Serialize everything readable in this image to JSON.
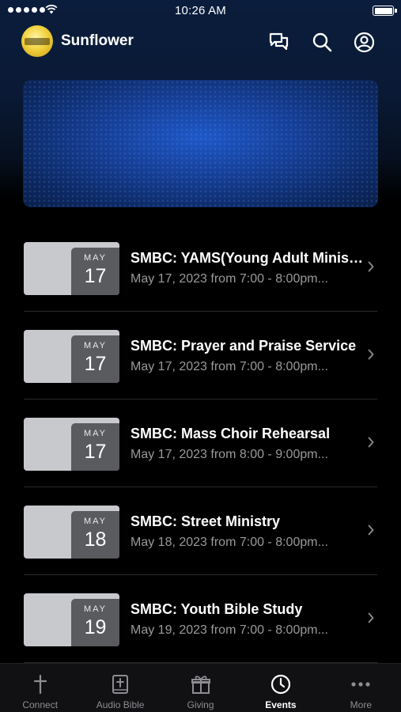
{
  "status_bar": {
    "time": "10:26 AM"
  },
  "header": {
    "app_name": "Sunflower"
  },
  "events": [
    {
      "month": "MAY",
      "day": "17",
      "title": "SMBC: YAMS(Young Adult Ministry)",
      "time": "May 17, 2023 from 7:00 - 8:00pm..."
    },
    {
      "month": "MAY",
      "day": "17",
      "title": "SMBC: Prayer and Praise Service",
      "time": "May 17, 2023 from 7:00 - 8:00pm..."
    },
    {
      "month": "MAY",
      "day": "17",
      "title": "SMBC: Mass Choir Rehearsal",
      "time": "May 17, 2023 from 8:00 - 9:00pm..."
    },
    {
      "month": "MAY",
      "day": "18",
      "title": "SMBC: Street Ministry",
      "time": "May 18, 2023 from 7:00 - 8:00pm..."
    },
    {
      "month": "MAY",
      "day": "19",
      "title": "SMBC: Youth Bible Study",
      "time": "May 19, 2023 from 7:00 - 8:00pm..."
    }
  ],
  "tabs": [
    {
      "label": "Connect",
      "icon": "cross-icon"
    },
    {
      "label": "Audio Bible",
      "icon": "bible-icon"
    },
    {
      "label": "Giving",
      "icon": "gift-icon"
    },
    {
      "label": "Events",
      "icon": "clock-icon",
      "active": true
    },
    {
      "label": "More",
      "icon": "more-icon"
    }
  ],
  "colors": {
    "accent": "#ffffff",
    "inactive": "#8d8d92",
    "banner": "#1e58c8"
  }
}
